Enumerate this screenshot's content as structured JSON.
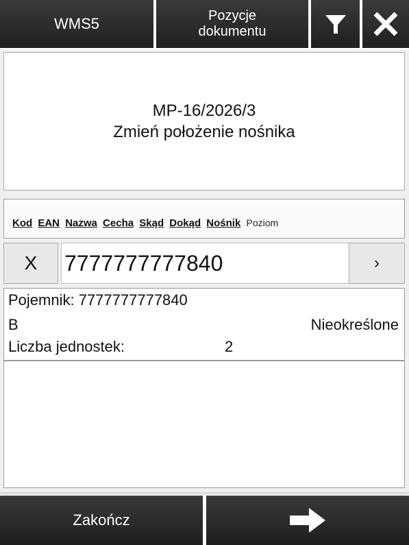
{
  "topbar": {
    "app_title": "WMS5",
    "view_title_line1": "Pozycje",
    "view_title_line2": "dokumentu",
    "filter_icon": "filter-icon",
    "close_icon": "close-icon"
  },
  "document": {
    "number": "MP-16/2026/3",
    "operation": "Zmień położenie nośnika"
  },
  "tabs": {
    "kod": "Kod",
    "ean": "EAN",
    "nazwa": "Nazwa",
    "cecha": "Cecha",
    "skad": "Skąd",
    "dokad": "Dokąd",
    "nosnik": "Nośnik",
    "poziom": "Poziom"
  },
  "scan": {
    "clear_label": "X",
    "value": "7777777777840",
    "go_label": "›"
  },
  "items": [
    {
      "container": "Pojemnik: 7777777777840",
      "location": "B",
      "status": "Nieokreślone",
      "qty_label": "Liczba jednostek:",
      "qty_value": "2"
    }
  ],
  "bottombar": {
    "finish_label": "Zakończ",
    "next_icon": "arrow-right-icon"
  },
  "colors": {
    "bar_dark": "#2a2a2a",
    "background": "#f0f0f0",
    "panel": "#ffffff"
  }
}
